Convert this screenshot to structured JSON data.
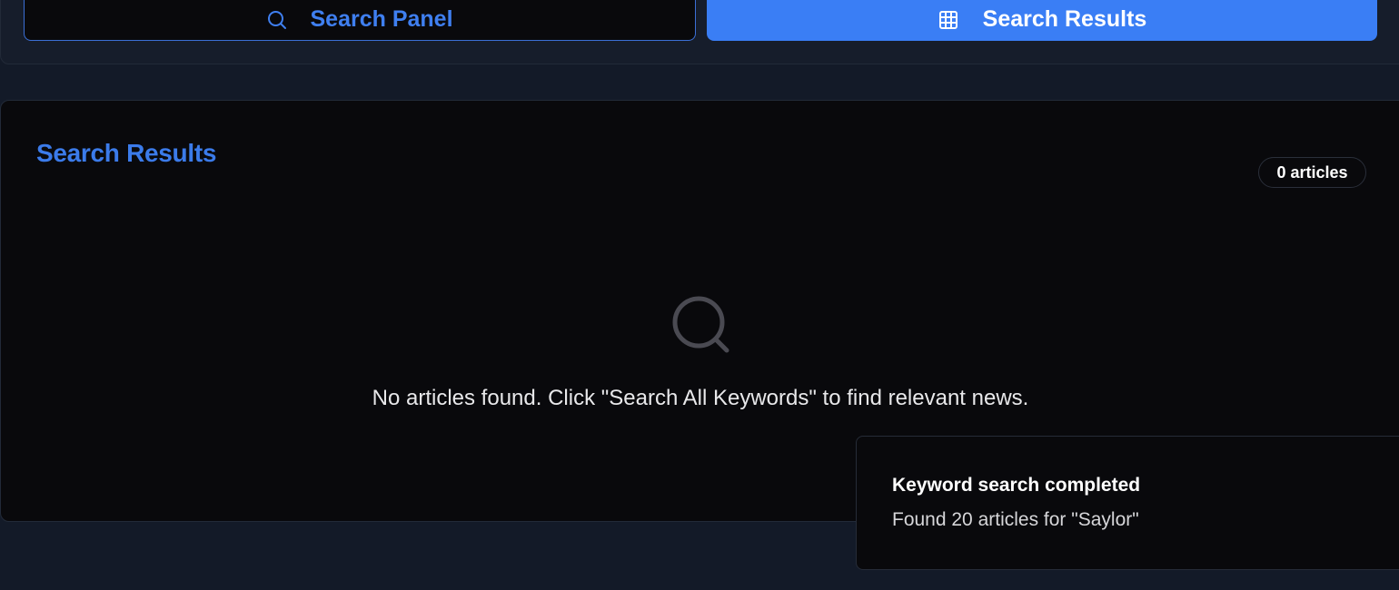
{
  "tabs": {
    "search_panel": {
      "label": "Search Panel",
      "icon": "search-icon"
    },
    "search_results": {
      "label": "Search Results",
      "icon": "grid-icon",
      "active": true
    }
  },
  "results": {
    "title": "Search Results",
    "count_label": "0 articles",
    "empty_icon": "search-icon",
    "empty_message": "No articles found. Click \"Search All Keywords\" to find relevant news."
  },
  "toast": {
    "title": "Keyword search completed",
    "description": "Found 20 articles for \"Saylor\""
  },
  "colors": {
    "background": "#131a28",
    "card": "#09090c",
    "accent": "#3a7ef5",
    "accent_text": "#3b7bea"
  }
}
